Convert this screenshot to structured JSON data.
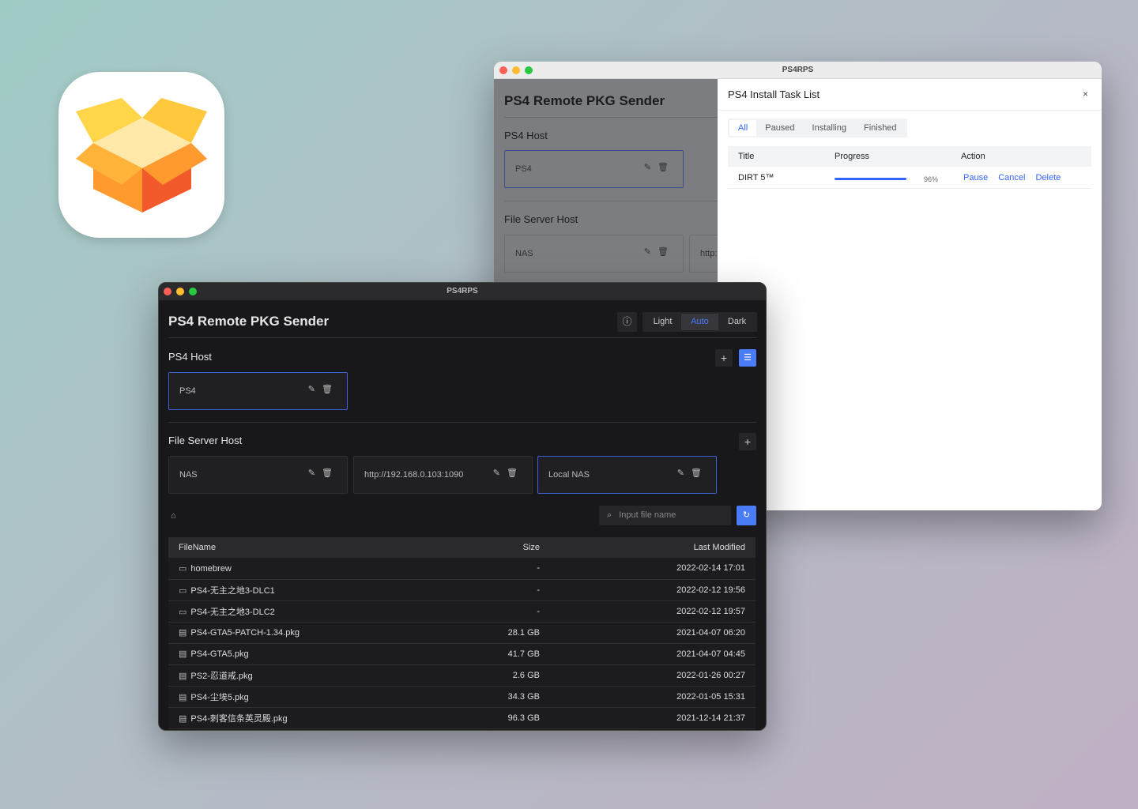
{
  "colors": {
    "accent": "#3366ff",
    "accent_dark": "#4a7cf7",
    "box_orange": "#ff8a2a",
    "box_red": "#f0562c",
    "box_yellow": "#ffc83d"
  },
  "back_window": {
    "title": "PS4RPS",
    "app_title": "PS4 Remote PKG Sender",
    "ps4_host_label": "PS4 Host",
    "ps4_hosts": [
      "PS4"
    ],
    "file_server_label": "File Server Host",
    "file_servers": [
      "NAS",
      "http:"
    ],
    "drawer": {
      "title": "PS4 Install Task List",
      "close": "×",
      "tabs": [
        {
          "label": "All",
          "active": true
        },
        {
          "label": "Paused"
        },
        {
          "label": "Installing"
        },
        {
          "label": "Finished"
        }
      ],
      "columns": [
        "Title",
        "Progress",
        "Action"
      ],
      "tasks": [
        {
          "title": "DIRT 5™",
          "progress": 96,
          "progress_label": "96%",
          "actions": [
            "Pause",
            "Cancel",
            "Delete"
          ]
        }
      ]
    }
  },
  "front_window": {
    "title": "PS4RPS",
    "app_title": "PS4 Remote PKG Sender",
    "info_icon": "info-circle-icon",
    "theme_options": [
      {
        "label": "Light"
      },
      {
        "label": "Auto",
        "active": true
      },
      {
        "label": "Dark"
      }
    ],
    "ps4_host_label": "PS4 Host",
    "ps4_hosts": [
      {
        "name": "PS4",
        "selected": true
      }
    ],
    "file_server_label": "File Server Host",
    "file_servers": [
      {
        "name": "NAS"
      },
      {
        "name": "http://192.168.0.103:1090"
      },
      {
        "name": "Local NAS",
        "selected": true
      }
    ],
    "search_placeholder": "Input file name",
    "columns": [
      "FileName",
      "Size",
      "Last Modified"
    ],
    "files": [
      {
        "type": "folder",
        "name": "homebrew",
        "size": "-",
        "modified": "2022-02-14 17:01"
      },
      {
        "type": "folder",
        "name": "PS4-无主之地3-DLC1",
        "size": "-",
        "modified": "2022-02-12 19:56"
      },
      {
        "type": "folder",
        "name": "PS4-无主之地3-DLC2",
        "size": "-",
        "modified": "2022-02-12 19:57"
      },
      {
        "type": "file",
        "name": "PS4-GTA5-PATCH-1.34.pkg",
        "size": "28.1 GB",
        "modified": "2021-04-07 06:20"
      },
      {
        "type": "file",
        "name": "PS4-GTA5.pkg",
        "size": "41.7 GB",
        "modified": "2021-04-07 04:45"
      },
      {
        "type": "file",
        "name": "PS2-忍道戒.pkg",
        "size": "2.6 GB",
        "modified": "2022-01-26 00:27"
      },
      {
        "type": "file",
        "name": "PS4-尘埃5.pkg",
        "size": "34.3 GB",
        "modified": "2022-01-05 15:31"
      },
      {
        "type": "file",
        "name": "PS4-刺客信条英灵殿.pkg",
        "size": "96.3 GB",
        "modified": "2021-12-14 21:37"
      }
    ]
  }
}
